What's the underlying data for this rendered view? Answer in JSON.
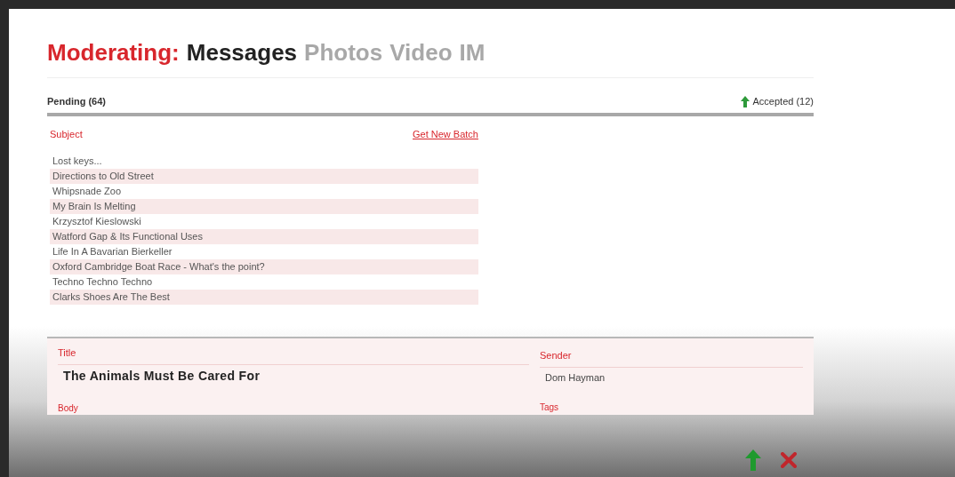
{
  "header": {
    "label": "Moderating:",
    "tabs": [
      {
        "label": "Messages",
        "selected": true
      },
      {
        "label": "Photos",
        "selected": false
      },
      {
        "label": "Video",
        "selected": false
      },
      {
        "label": "IM",
        "selected": false
      }
    ]
  },
  "queue_bar": {
    "pending": "Pending (64)",
    "accepted": "Accepted (12)"
  },
  "list": {
    "column": "Subject",
    "action": "Get New Batch",
    "rows": [
      {
        "subject": "Lost keys..."
      },
      {
        "subject": "Directions to Old Street"
      },
      {
        "subject": "Whipsnade Zoo"
      },
      {
        "subject": "My Brain Is Melting"
      },
      {
        "subject": "Krzysztof Kieslowski"
      },
      {
        "subject": "Watford Gap & Its Functional Uses"
      },
      {
        "subject": "Life In A Bavarian Bierkeller"
      },
      {
        "subject": "Oxford Cambridge Boat Race - What's the point?"
      },
      {
        "subject": "Techno Techno Techno"
      },
      {
        "subject": "Clarks Shoes Are The Best"
      }
    ]
  },
  "detail": {
    "title_label": "Title",
    "title": "The Animals Must Be Cared For",
    "sender_label": "Sender",
    "sender": "Dom Hayman",
    "body_label": "Body",
    "tags_label": "Tags"
  }
}
